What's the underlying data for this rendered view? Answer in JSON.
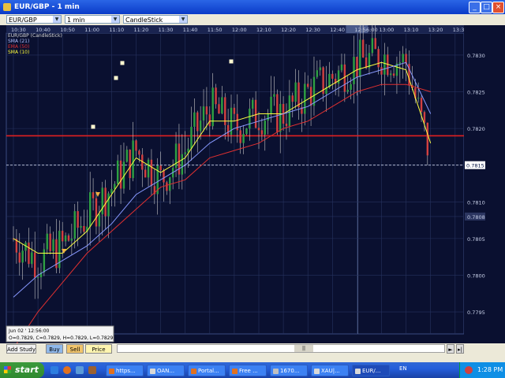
{
  "window": {
    "title": "EUR/GBP - 1 min"
  },
  "toolbar": {
    "pair": "EUR/GBP",
    "interval": "1 min",
    "chart_type": "CandleStick"
  },
  "chart": {
    "legend": [
      {
        "text": "EUR/GBP (CandleStick)",
        "color": "#d8d8d8"
      },
      {
        "text": "SMA (21)",
        "color": "#b0c0ff"
      },
      {
        "text": "EMA (50)",
        "color": "#e03030"
      },
      {
        "text": "SMA (10)",
        "color": "#ffff40"
      }
    ],
    "time_labels": [
      "10:30",
      "10:40",
      "10:50",
      "11:00",
      "11:10",
      "11:20",
      "11:30",
      "11:40",
      "11:50",
      "12:00",
      "12:10",
      "12:20",
      "12:30",
      "12:40",
      "12:56:00",
      "13:00",
      "13:10",
      "13:20",
      "13:3"
    ],
    "price_labels": [
      "0.7830",
      "0.7825",
      "0.7820",
      "0.7815",
      "0.7810",
      "0.7808",
      "0.7805",
      "0.7800",
      "0.7795"
    ],
    "current_price": "0.7815",
    "info_box": {
      "line1": "Jun 02 ' 12:56:00",
      "line2": "O=0.7829, C=0.7829, H=0.7829, L=0.7829"
    },
    "colors": {
      "up": "#2ea043",
      "down": "#d24040",
      "sma10": "#ffff40",
      "sma21": "#8899ff",
      "ema50": "#e03030",
      "hline": "#e02020"
    }
  },
  "chart_data": {
    "type": "candlestick",
    "x": [
      "10:30",
      "10:40",
      "10:50",
      "11:00",
      "11:10",
      "11:20",
      "11:30",
      "11:40",
      "11:50",
      "12:00",
      "12:10",
      "12:20",
      "12:30",
      "12:40",
      "12:56:00",
      "13:00",
      "13:10",
      "13:20"
    ],
    "close": [
      0.7805,
      0.7802,
      0.7804,
      0.7808,
      0.7812,
      0.7817,
      0.7813,
      0.7817,
      0.7823,
      0.782,
      0.7822,
      0.7822,
      0.7825,
      0.7827,
      0.7829,
      0.783,
      0.7829,
      0.7816
    ],
    "series": [
      {
        "name": "SMA (10)",
        "values": [
          0.7805,
          0.7803,
          0.7803,
          0.7806,
          0.7811,
          0.7816,
          0.7814,
          0.7816,
          0.7821,
          0.7821,
          0.7822,
          0.7822,
          0.7824,
          0.7826,
          0.7828,
          0.7829,
          0.7828,
          0.7818
        ]
      },
      {
        "name": "SMA (21)",
        "values": [
          0.7797,
          0.78,
          0.7802,
          0.7804,
          0.7807,
          0.7811,
          0.7813,
          0.7815,
          0.7818,
          0.782,
          0.7821,
          0.7822,
          0.7823,
          0.7825,
          0.7827,
          0.7828,
          0.7829,
          0.7822
        ]
      },
      {
        "name": "EMA (50)",
        "values": [
          0.779,
          0.7795,
          0.7799,
          0.7803,
          0.7806,
          0.7809,
          0.7812,
          0.7813,
          0.7816,
          0.7817,
          0.7818,
          0.782,
          0.7821,
          0.7823,
          0.7825,
          0.7826,
          0.7826,
          0.7825
        ]
      }
    ],
    "horizontal_line": 0.7819,
    "last_price": 0.7815,
    "ylim": [
      0.7792,
      0.7833
    ]
  },
  "bottom": {
    "add_study": "Add Study",
    "buy": "Buy",
    "sell": "Sell",
    "price_box": "Price Box"
  },
  "taskbar": {
    "start": "start",
    "tasks": [
      "https...",
      "OAN...",
      "Portal...",
      "Free ...",
      "1670...",
      "XAU|...",
      "EUR/..."
    ],
    "lang": "EN",
    "clock": "1:28 PM"
  }
}
